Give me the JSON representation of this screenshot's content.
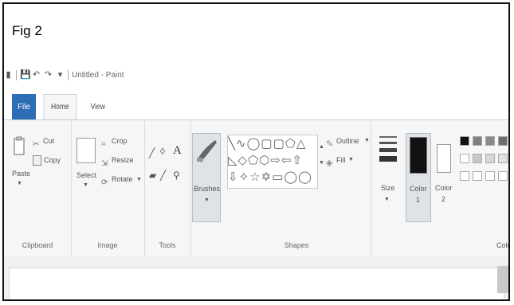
{
  "figure_label": "Fig 2",
  "titlebar": {
    "title": "Untitled - Paint"
  },
  "tabs": [
    "File",
    "Home",
    "View"
  ],
  "clipboard": {
    "paste": "Paste",
    "cut": "Cut",
    "copy": "Copy",
    "group": "Clipboard"
  },
  "image": {
    "select": "Select",
    "crop": "Crop",
    "resize": "Resize",
    "rotate": "Rotate",
    "group": "Image"
  },
  "tools": {
    "text_tool": "A",
    "group": "Tools"
  },
  "brushes": {
    "label": "Brushes"
  },
  "shapes": {
    "outline": "Outline",
    "fill": "Fill",
    "group": "Shapes"
  },
  "size": {
    "label": "Size"
  },
  "color1": {
    "label": "Color",
    "number": "1"
  },
  "color2": {
    "label": "Color",
    "number": "2"
  },
  "colors": {
    "group": "Colors"
  },
  "palette": {
    "row1": [
      "#111111",
      "#7f7f7f",
      "#8a8a8a",
      "#6e6e6e",
      "#9a9a9a"
    ],
    "row2": [
      "#ffffff",
      "#c8c8c8",
      "#d7d7d7",
      "#e2e2e2",
      "#ededed"
    ]
  },
  "accent_color": "#2c6db5"
}
